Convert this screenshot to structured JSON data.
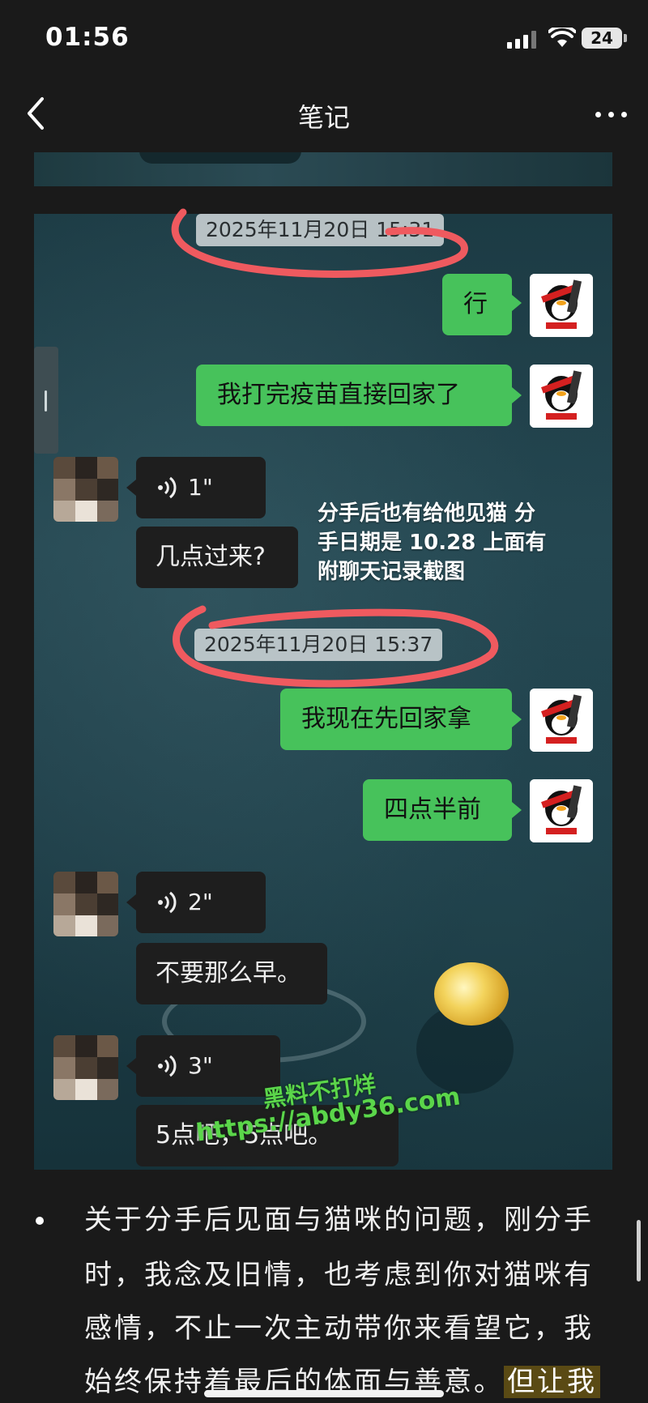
{
  "status_bar": {
    "time": "01:56",
    "battery": "24"
  },
  "nav": {
    "title": "笔记"
  },
  "chat": {
    "timestamps": [
      "2025年11月20日 15:31",
      "2025年11月20日 15:37"
    ],
    "messages": [
      {
        "side": "out",
        "text": "行"
      },
      {
        "side": "out",
        "text": "我打完疫苗直接回家了"
      },
      {
        "side": "in",
        "voice": "1\""
      },
      {
        "side": "in",
        "text": "几点过来?"
      },
      {
        "side": "out",
        "text": "我现在先回家拿"
      },
      {
        "side": "out",
        "text": "四点半前"
      },
      {
        "side": "in",
        "voice": "2\""
      },
      {
        "side": "in",
        "text": "不要那么早。"
      },
      {
        "side": "in",
        "voice": "3\""
      },
      {
        "side": "in",
        "text": "5点吧，5点吧。"
      }
    ],
    "annotation_lines": [
      "分手后也有给他见猫 分",
      "手日期是 10.28 上面有",
      "附聊天记录截图"
    ]
  },
  "watermark": {
    "line1": "黑料不打烊",
    "line2": "https://abdy36.com"
  },
  "note": {
    "lines": [
      "关于分手后见面与猫咪的问题，刚分手",
      "时，我念及旧情，也考虑到你对猫咪有",
      "感情，不止一次主动带你来看望它，我",
      "始终保持着最后的体面与善意。"
    ],
    "highlight": "但让我"
  },
  "colors": {
    "bubble_out": "#47c25b",
    "bubble_in": "#1e1e1e",
    "circle_annotation": "#ef5a5f",
    "watermark": "#5bd64a"
  },
  "icons": [
    "back-arrow-icon",
    "more-dots-icon",
    "signal-icon",
    "wifi-icon",
    "battery-icon",
    "voice-wave-icon"
  ]
}
